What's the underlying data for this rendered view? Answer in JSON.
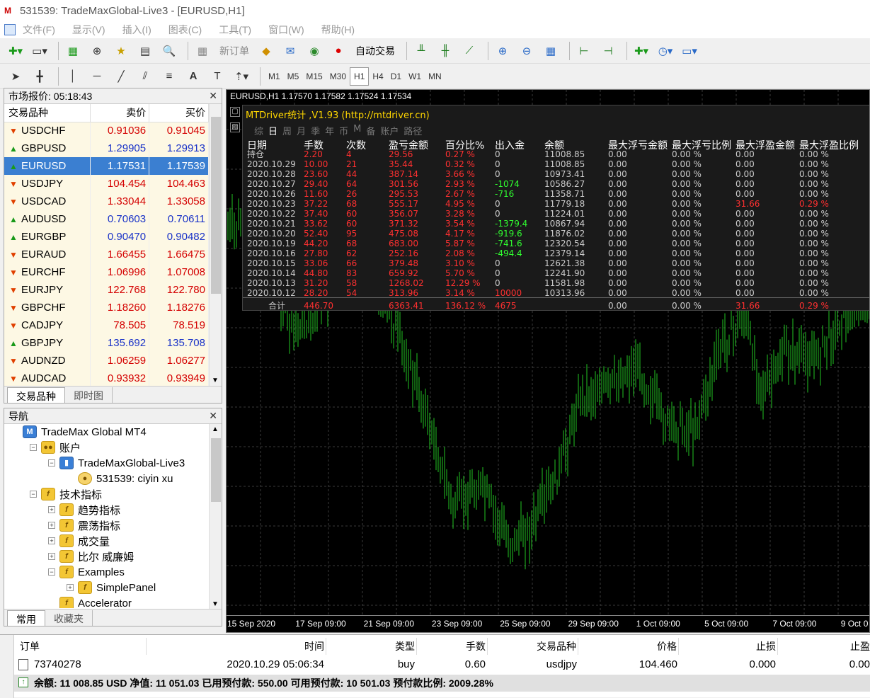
{
  "window": {
    "title": "531539: TradeMaxGlobal-Live3 - [EURUSD,H1]"
  },
  "menu": [
    "文件(F)",
    "显示(V)",
    "插入(I)",
    "图表(C)",
    "工具(T)",
    "窗口(W)",
    "帮助(H)"
  ],
  "toolbar1": {
    "new_order": "新订单",
    "auto_trade": "自动交易"
  },
  "toolbar2": {
    "text_tool": "A",
    "timeframes": [
      "M1",
      "M5",
      "M15",
      "M30",
      "H1",
      "H4",
      "D1",
      "W1",
      "MN"
    ],
    "active_timeframe": "H1"
  },
  "market_watch": {
    "title": "市场报价: 05:18:43",
    "columns": [
      "交易品种",
      "卖价",
      "买价"
    ],
    "rows": [
      {
        "symbol": "USDCHF",
        "bid": "0.91036",
        "ask": "0.91045",
        "dir": "down"
      },
      {
        "symbol": "GBPUSD",
        "bid": "1.29905",
        "ask": "1.29913",
        "dir": "up"
      },
      {
        "symbol": "EURUSD",
        "bid": "1.17531",
        "ask": "1.17539",
        "dir": "up",
        "selected": true
      },
      {
        "symbol": "USDJPY",
        "bid": "104.454",
        "ask": "104.463",
        "dir": "down"
      },
      {
        "symbol": "USDCAD",
        "bid": "1.33044",
        "ask": "1.33058",
        "dir": "down"
      },
      {
        "symbol": "AUDUSD",
        "bid": "0.70603",
        "ask": "0.70611",
        "dir": "up"
      },
      {
        "symbol": "EURGBP",
        "bid": "0.90470",
        "ask": "0.90482",
        "dir": "up"
      },
      {
        "symbol": "EURAUD",
        "bid": "1.66455",
        "ask": "1.66475",
        "dir": "down"
      },
      {
        "symbol": "EURCHF",
        "bid": "1.06996",
        "ask": "1.07008",
        "dir": "down"
      },
      {
        "symbol": "EURJPY",
        "bid": "122.768",
        "ask": "122.780",
        "dir": "down"
      },
      {
        "symbol": "GBPCHF",
        "bid": "1.18260",
        "ask": "1.18276",
        "dir": "down"
      },
      {
        "symbol": "CADJPY",
        "bid": "78.505",
        "ask": "78.519",
        "dir": "down"
      },
      {
        "symbol": "GBPJPY",
        "bid": "135.692",
        "ask": "135.708",
        "dir": "up"
      },
      {
        "symbol": "AUDNZD",
        "bid": "1.06259",
        "ask": "1.06277",
        "dir": "down"
      },
      {
        "symbol": "AUDCAD",
        "bid": "0.93932",
        "ask": "0.93949",
        "dir": "down"
      }
    ],
    "tabs": [
      "交易品种",
      "即时图"
    ]
  },
  "navigator": {
    "title": "导航",
    "items": [
      {
        "label": "TradeMax Global MT4",
        "level": 0,
        "exp": "",
        "icon": "terminal"
      },
      {
        "label": "账户",
        "level": 1,
        "exp": "−",
        "icon": "accounts"
      },
      {
        "label": "TradeMaxGlobal-Live3",
        "level": 2,
        "exp": "−",
        "icon": "server"
      },
      {
        "label": "531539: ciyin xu",
        "level": 3,
        "exp": "",
        "icon": "person"
      },
      {
        "label": "技术指标",
        "level": 1,
        "exp": "−",
        "icon": "indicator"
      },
      {
        "label": "趋势指标",
        "level": 2,
        "exp": "+",
        "icon": "indicator"
      },
      {
        "label": "震荡指标",
        "level": 2,
        "exp": "+",
        "icon": "indicator"
      },
      {
        "label": "成交量",
        "level": 2,
        "exp": "+",
        "icon": "indicator"
      },
      {
        "label": "比尔 威廉姆",
        "level": 2,
        "exp": "+",
        "icon": "indicator"
      },
      {
        "label": "Examples",
        "level": 2,
        "exp": "−",
        "icon": "indicator"
      },
      {
        "label": "SimplePanel",
        "level": 3,
        "exp": "+",
        "icon": "indicator"
      },
      {
        "label": "Accelerator",
        "level": 2,
        "exp": "",
        "icon": "indicator"
      }
    ],
    "tabs": [
      "常用",
      "收藏夹"
    ]
  },
  "chart": {
    "header": "EURUSD,H1  1.17570 1.17582 1.17524 1.17534",
    "x_labels": [
      "15 Sep 2020",
      "17 Sep 09:00",
      "21 Sep 09:00",
      "23 Sep 09:00",
      "25 Sep 09:00",
      "29 Sep 09:00",
      "1 Oct 09:00",
      "5 Oct 09:00",
      "7 Oct 09:00",
      "9 Oct 0"
    ],
    "candle_color": "#22c522",
    "grid_color": "#3a3a3a"
  },
  "stats": {
    "title": "MTDriver统计 ,V1.93 (http://mtdriver.cn)",
    "tabs": [
      "综",
      "日",
      "周",
      "月",
      "季",
      "年",
      "币",
      "M",
      "备",
      "账户",
      "路径"
    ],
    "active_tab": "日",
    "headers": [
      "日期",
      "手数",
      "次数",
      "盈亏金额",
      "百分比%",
      "出入金",
      "余额",
      "最大浮亏金额",
      "最大浮亏比例",
      "最大浮盈金额",
      "最大浮盈比例"
    ],
    "rows": [
      [
        "持仓",
        "2.20",
        "4",
        "29.56",
        "0.27 %",
        "0",
        "11008.85",
        "0.00",
        "0.00 %",
        "0.00",
        "0.00 %"
      ],
      [
        "2020.10.29",
        "10.00",
        "21",
        "35.44",
        "0.32 %",
        "0",
        "11008.85",
        "0.00",
        "0.00 %",
        "0.00",
        "0.00 %"
      ],
      [
        "2020.10.28",
        "23.60",
        "44",
        "387.14",
        "3.66 %",
        "0",
        "10973.41",
        "0.00",
        "0.00 %",
        "0.00",
        "0.00 %"
      ],
      [
        "2020.10.27",
        "29.40",
        "64",
        "301.56",
        "2.93 %",
        "-1074",
        "10586.27",
        "0.00",
        "0.00 %",
        "0.00",
        "0.00 %"
      ],
      [
        "2020.10.26",
        "11.60",
        "26",
        "295.53",
        "2.67 %",
        "-716",
        "11358.71",
        "0.00",
        "0.00 %",
        "0.00",
        "0.00 %"
      ],
      [
        "2020.10.23",
        "37.22",
        "68",
        "555.17",
        "4.95 %",
        "0",
        "11779.18",
        "0.00",
        "0.00 %",
        "31.66",
        "0.29 %"
      ],
      [
        "2020.10.22",
        "37.40",
        "60",
        "356.07",
        "3.28 %",
        "0",
        "11224.01",
        "0.00",
        "0.00 %",
        "0.00",
        "0.00 %"
      ],
      [
        "2020.10.21",
        "33.62",
        "60",
        "371.32",
        "3.54 %",
        "-1379.4",
        "10867.94",
        "0.00",
        "0.00 %",
        "0.00",
        "0.00 %"
      ],
      [
        "2020.10.20",
        "52.40",
        "95",
        "475.08",
        "4.17 %",
        "-919.6",
        "11876.02",
        "0.00",
        "0.00 %",
        "0.00",
        "0.00 %"
      ],
      [
        "2020.10.19",
        "44.20",
        "68",
        "683.00",
        "5.87 %",
        "-741.6",
        "12320.54",
        "0.00",
        "0.00 %",
        "0.00",
        "0.00 %"
      ],
      [
        "2020.10.16",
        "27.80",
        "62",
        "252.16",
        "2.08 %",
        "-494.4",
        "12379.14",
        "0.00",
        "0.00 %",
        "0.00",
        "0.00 %"
      ],
      [
        "2020.10.15",
        "33.06",
        "66",
        "379.48",
        "3.10 %",
        "0",
        "12621.38",
        "0.00",
        "0.00 %",
        "0.00",
        "0.00 %"
      ],
      [
        "2020.10.14",
        "44.80",
        "83",
        "659.92",
        "5.70 %",
        "0",
        "12241.90",
        "0.00",
        "0.00 %",
        "0.00",
        "0.00 %"
      ],
      [
        "2020.10.13",
        "31.20",
        "58",
        "1268.02",
        "12.29 %",
        "0",
        "11581.98",
        "0.00",
        "0.00 %",
        "0.00",
        "0.00 %"
      ],
      [
        "2020.10.12",
        "28.20",
        "54",
        "313.96",
        "3.14 %",
        "10000",
        "10313.96",
        "0.00",
        "0.00 %",
        "0.00",
        "0.00 %"
      ]
    ],
    "total": [
      "合计",
      "446.70",
      "",
      "6363.41",
      "136.12 %",
      "4675",
      "",
      "0.00",
      "0.00 %",
      "31.66",
      "0.29 %"
    ]
  },
  "terminal": {
    "headers": [
      "订单",
      "时间",
      "类型",
      "手数",
      "交易品种",
      "价格",
      "止损",
      "止盈"
    ],
    "order": {
      "ticket": "73740278",
      "time": "2020.10.29 05:06:34",
      "type": "buy",
      "lots": "0.60",
      "symbol": "usdjpy",
      "price": "104.460",
      "sl": "0.000",
      "tp": "0.00"
    },
    "balance_text": "余额: 11 008.85 USD  净值: 11 051.03  已用预付款: 550.00  可用预付款: 10 501.03  预付款比例: 2009.28%"
  }
}
